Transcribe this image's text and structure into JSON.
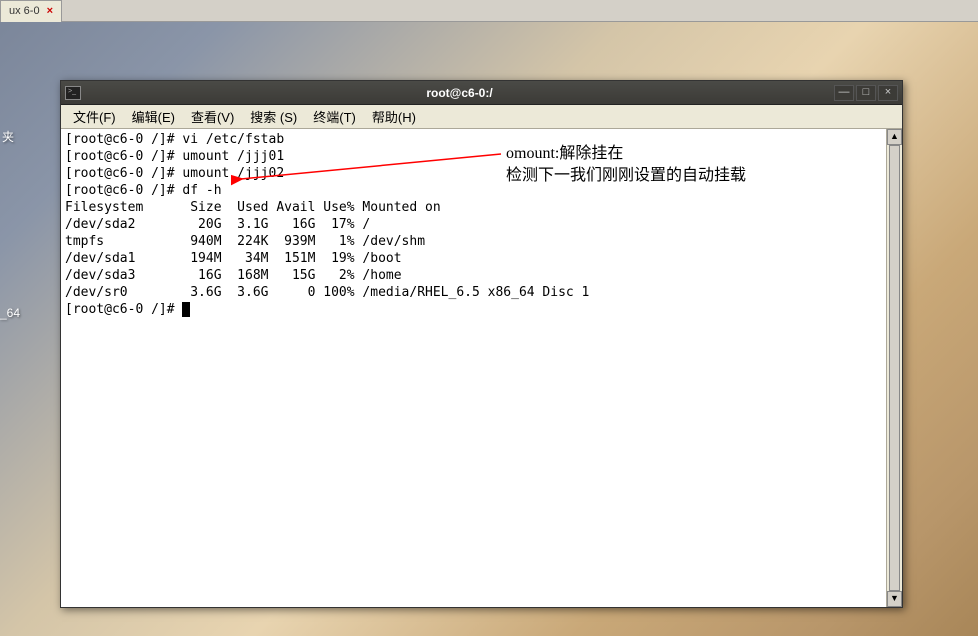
{
  "tab": {
    "label": "ux 6-0",
    "close": "×"
  },
  "desktop_labels": {
    "item1": "夹",
    "item2": "_64"
  },
  "terminal": {
    "title": "root@c6-0:/",
    "window_buttons": {
      "minimize": "—",
      "maximize": "□",
      "close": "×"
    },
    "menu": [
      "文件(F)",
      "编辑(E)",
      "查看(V)",
      "搜索 (S)",
      "终端(T)",
      "帮助(H)"
    ],
    "lines": [
      "[root@c6-0 /]# vi /etc/fstab",
      "[root@c6-0 /]# umount /jjj01",
      "[root@c6-0 /]# umount /jjj02",
      "[root@c6-0 /]# df -h",
      "Filesystem      Size  Used Avail Use% Mounted on",
      "/dev/sda2        20G  3.1G   16G  17% /",
      "tmpfs           940M  224K  939M   1% /dev/shm",
      "/dev/sda1       194M   34M  151M  19% /boot",
      "/dev/sda3        16G  168M   15G   2% /home",
      "/dev/sr0        3.6G  3.6G     0 100% /media/RHEL_6.5 x86_64 Disc 1",
      "[root@c6-0 /]# "
    ],
    "scrollbar": {
      "up": "▲",
      "down": "▼"
    }
  },
  "annotation": {
    "line1": "omount:解除挂在",
    "line2": "检测下一我们刚刚设置的自动挂载"
  }
}
